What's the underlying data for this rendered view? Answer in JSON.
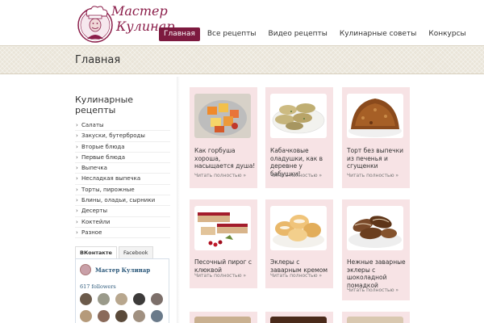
{
  "site": {
    "logo_line1": "Мастер",
    "logo_line2": "Кулинар"
  },
  "nav": {
    "items": [
      {
        "label": "Главная",
        "active": true
      },
      {
        "label": "Все рецепты"
      },
      {
        "label": "Видео рецепты"
      },
      {
        "label": "Кулинарные советы"
      },
      {
        "label": "Конкурсы"
      }
    ]
  },
  "page_title": "Главная",
  "sidebar": {
    "title": "Кулинарные рецепты",
    "items": [
      "Салаты",
      "Закуски, бутерброды",
      "Вторые блюда",
      "Первые блюда",
      "Выпечка",
      "Несладкая выпечка",
      "Торты, пирожные",
      "Блины, оладьи, сырники",
      "Десерты",
      "Коктейли",
      "Разное"
    ]
  },
  "social": {
    "tabs": [
      "ВКонтакте",
      "Facebook"
    ],
    "group_name": "Мастер Кулинар",
    "followers": "617 followers"
  },
  "more_label": "Читать полностью »",
  "cards": [
    {
      "title": "Как горбуша хороша, насыщается душа!"
    },
    {
      "title": "Кабачковые оладушки, как в деревне у бабушки!"
    },
    {
      "title": "Торт без выпечки из печенья и сгущенки"
    },
    {
      "title": "Песочный пирог с клюквой"
    },
    {
      "title": "Эклеры с заварным кремом"
    },
    {
      "title": "Нежные заварные эклеры с шоколадной помадкой"
    }
  ],
  "colors": {
    "accent": "#7d1a3f",
    "card_bg": "#f7e3e5",
    "band_bg": "#eae5d9"
  }
}
